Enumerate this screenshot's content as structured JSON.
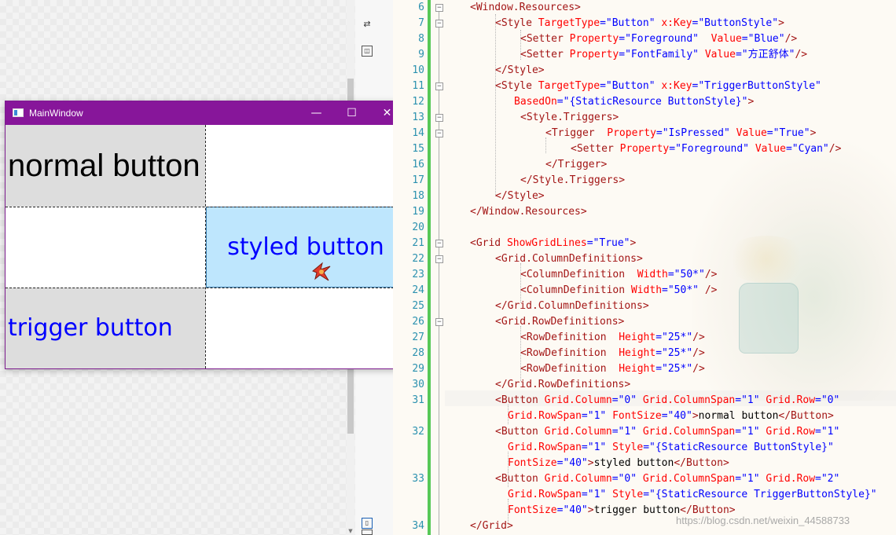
{
  "designer": {
    "window": {
      "title": "MainWindow",
      "minimize_glyph": "—",
      "maximize_glyph": "☐",
      "close_glyph": "✕",
      "title_bar_color": "#87169a"
    },
    "buttons": {
      "normal": "normal button",
      "styled": "styled button",
      "trigger": "trigger button"
    },
    "colors": {
      "button_bg": "#dddddd",
      "hover_bg": "#bee6fd",
      "blue_text": "#0000ff"
    },
    "icons": {
      "swap": "swap-icon",
      "pin": "pin-icon",
      "split": "split-view-icon",
      "cursor": "cursor-icon"
    }
  },
  "editor": {
    "line_numbers": [
      "6",
      "7",
      "8",
      "9",
      "10",
      "11",
      "12",
      "13",
      "14",
      "15",
      "16",
      "17",
      "18",
      "19",
      "20",
      "21",
      "22",
      "23",
      "24",
      "25",
      "26",
      "27",
      "28",
      "29",
      "30",
      "31",
      "32",
      "33",
      "34"
    ],
    "lines": [
      [
        {
          "c": "tag",
          "t": "<Window.Resources>"
        }
      ],
      [
        {
          "c": "tag",
          "t": "<Style "
        },
        {
          "c": "attr",
          "t": "TargetType"
        },
        {
          "c": "val",
          "t": "=\"Button\" "
        },
        {
          "c": "attr",
          "t": "x:Key"
        },
        {
          "c": "val",
          "t": "=\"ButtonStyle\""
        },
        {
          "c": "tag",
          "t": ">"
        }
      ],
      [
        {
          "c": "tag",
          "t": "<Setter "
        },
        {
          "c": "attr",
          "t": "Property"
        },
        {
          "c": "val",
          "t": "=\"Foreground\"  "
        },
        {
          "c": "attr",
          "t": "Value"
        },
        {
          "c": "val",
          "t": "=\"Blue\""
        },
        {
          "c": "tag",
          "t": "/>"
        }
      ],
      [
        {
          "c": "tag",
          "t": "<Setter "
        },
        {
          "c": "attr",
          "t": "Property"
        },
        {
          "c": "val",
          "t": "=\"FontFamily\" "
        },
        {
          "c": "attr",
          "t": "Value"
        },
        {
          "c": "val",
          "t": "=\"方正舒体\""
        },
        {
          "c": "tag",
          "t": "/>"
        }
      ],
      [
        {
          "c": "tag",
          "t": "</Style>"
        }
      ],
      [
        {
          "c": "tag",
          "t": "<Style "
        },
        {
          "c": "attr",
          "t": "TargetType"
        },
        {
          "c": "val",
          "t": "=\"Button\" "
        },
        {
          "c": "attr",
          "t": "x:Key"
        },
        {
          "c": "val",
          "t": "=\"TriggerButtonStyle\""
        }
      ],
      [
        {
          "c": "attr",
          "t": "BasedOn"
        },
        {
          "c": "val",
          "t": "=\"{StaticResource ButtonStyle}\""
        },
        {
          "c": "tag",
          "t": ">"
        }
      ],
      [
        {
          "c": "tag",
          "t": "<Style.Triggers>"
        }
      ],
      [
        {
          "c": "tag",
          "t": "<Trigger  "
        },
        {
          "c": "attr",
          "t": "Property"
        },
        {
          "c": "val",
          "t": "=\"IsPressed\" "
        },
        {
          "c": "attr",
          "t": "Value"
        },
        {
          "c": "val",
          "t": "=\"True\""
        },
        {
          "c": "tag",
          "t": ">"
        }
      ],
      [
        {
          "c": "tag",
          "t": "<Setter "
        },
        {
          "c": "attr",
          "t": "Property"
        },
        {
          "c": "val",
          "t": "=\"Foreground\" "
        },
        {
          "c": "attr",
          "t": "Value"
        },
        {
          "c": "val",
          "t": "=\"Cyan\""
        },
        {
          "c": "tag",
          "t": "/>"
        }
      ],
      [
        {
          "c": "tag",
          "t": "</Trigger>"
        }
      ],
      [
        {
          "c": "tag",
          "t": "</Style.Triggers>"
        }
      ],
      [
        {
          "c": "tag",
          "t": "</Style>"
        }
      ],
      [
        {
          "c": "tag",
          "t": "</Window.Resources>"
        }
      ],
      [],
      [
        {
          "c": "tag",
          "t": "<Grid "
        },
        {
          "c": "attr",
          "t": "ShowGridLines"
        },
        {
          "c": "val",
          "t": "=\"True\""
        },
        {
          "c": "tag",
          "t": ">"
        }
      ],
      [
        {
          "c": "tag",
          "t": "<Grid.ColumnDefinitions>"
        }
      ],
      [
        {
          "c": "tag",
          "t": "<ColumnDefinition  "
        },
        {
          "c": "attr",
          "t": "Width"
        },
        {
          "c": "val",
          "t": "=\"50*\""
        },
        {
          "c": "tag",
          "t": "/>"
        }
      ],
      [
        {
          "c": "tag",
          "t": "<ColumnDefinition "
        },
        {
          "c": "attr",
          "t": "Width"
        },
        {
          "c": "val",
          "t": "=\"50*\" "
        },
        {
          "c": "tag",
          "t": "/>"
        }
      ],
      [
        {
          "c": "tag",
          "t": "</Grid.ColumnDefinitions>"
        }
      ],
      [
        {
          "c": "tag",
          "t": "<Grid.RowDefinitions>"
        }
      ],
      [
        {
          "c": "tag",
          "t": "<RowDefinition  "
        },
        {
          "c": "attr",
          "t": "Height"
        },
        {
          "c": "val",
          "t": "=\"25*\""
        },
        {
          "c": "tag",
          "t": "/>"
        }
      ],
      [
        {
          "c": "tag",
          "t": "<RowDefinition  "
        },
        {
          "c": "attr",
          "t": "Height"
        },
        {
          "c": "val",
          "t": "=\"25*\""
        },
        {
          "c": "tag",
          "t": "/>"
        }
      ],
      [
        {
          "c": "tag",
          "t": "<RowDefinition  "
        },
        {
          "c": "attr",
          "t": "Height"
        },
        {
          "c": "val",
          "t": "=\"25*\""
        },
        {
          "c": "tag",
          "t": "/>"
        }
      ],
      [
        {
          "c": "tag",
          "t": "</Grid.RowDefinitions>"
        }
      ],
      [
        {
          "c": "tag",
          "t": "<Button "
        },
        {
          "c": "attr",
          "t": "Grid.Column"
        },
        {
          "c": "val",
          "t": "=\"0\" "
        },
        {
          "c": "attr",
          "t": "Grid.ColumnSpan"
        },
        {
          "c": "val",
          "t": "=\"1\" "
        },
        {
          "c": "attr",
          "t": "Grid.Row"
        },
        {
          "c": "val",
          "t": "=\"0\""
        }
      ],
      [
        {
          "c": "attr",
          "t": "Grid.RowSpan"
        },
        {
          "c": "val",
          "t": "=\"1\" "
        },
        {
          "c": "attr",
          "t": "FontSize"
        },
        {
          "c": "val",
          "t": "=\"40\""
        },
        {
          "c": "tag",
          "t": ">"
        },
        {
          "c": "txt",
          "t": "normal button"
        },
        {
          "c": "tag",
          "t": "</Button>"
        }
      ],
      [
        {
          "c": "tag",
          "t": "<Button "
        },
        {
          "c": "attr",
          "t": "Grid.Column"
        },
        {
          "c": "val",
          "t": "=\"1\" "
        },
        {
          "c": "attr",
          "t": "Grid.ColumnSpan"
        },
        {
          "c": "val",
          "t": "=\"1\" "
        },
        {
          "c": "attr",
          "t": "Grid.Row"
        },
        {
          "c": "val",
          "t": "=\"1\""
        }
      ],
      [
        {
          "c": "attr",
          "t": "Grid.RowSpan"
        },
        {
          "c": "val",
          "t": "=\"1\" "
        },
        {
          "c": "attr",
          "t": "Style"
        },
        {
          "c": "val",
          "t": "=\"{StaticResource ButtonStyle}\""
        }
      ],
      [
        {
          "c": "attr",
          "t": "FontSize"
        },
        {
          "c": "val",
          "t": "=\"40\""
        },
        {
          "c": "tag",
          "t": ">"
        },
        {
          "c": "txt",
          "t": "styled button"
        },
        {
          "c": "tag",
          "t": "</Button>"
        }
      ],
      [
        {
          "c": "tag",
          "t": "<Button "
        },
        {
          "c": "attr",
          "t": "Grid.Column"
        },
        {
          "c": "val",
          "t": "=\"0\" "
        },
        {
          "c": "attr",
          "t": "Grid.ColumnSpan"
        },
        {
          "c": "val",
          "t": "=\"1\" "
        },
        {
          "c": "attr",
          "t": "Grid.Row"
        },
        {
          "c": "val",
          "t": "=\"2\""
        }
      ],
      [
        {
          "c": "attr",
          "t": "Grid.RowSpan"
        },
        {
          "c": "val",
          "t": "=\"1\" "
        },
        {
          "c": "attr",
          "t": "Style"
        },
        {
          "c": "val",
          "t": "=\"{StaticResource TriggerButtonStyle}\""
        }
      ],
      [
        {
          "c": "attr",
          "t": "FontSize"
        },
        {
          "c": "val",
          "t": "=\"40\""
        },
        {
          "c": "tag",
          "t": ">"
        },
        {
          "c": "txt",
          "t": "trigger button"
        },
        {
          "c": "tag",
          "t": "</Button>"
        }
      ],
      [
        {
          "c": "tag",
          "t": "</Grid>"
        }
      ]
    ],
    "watermark": "https://blog.csdn.net/weixin_44588733"
  }
}
